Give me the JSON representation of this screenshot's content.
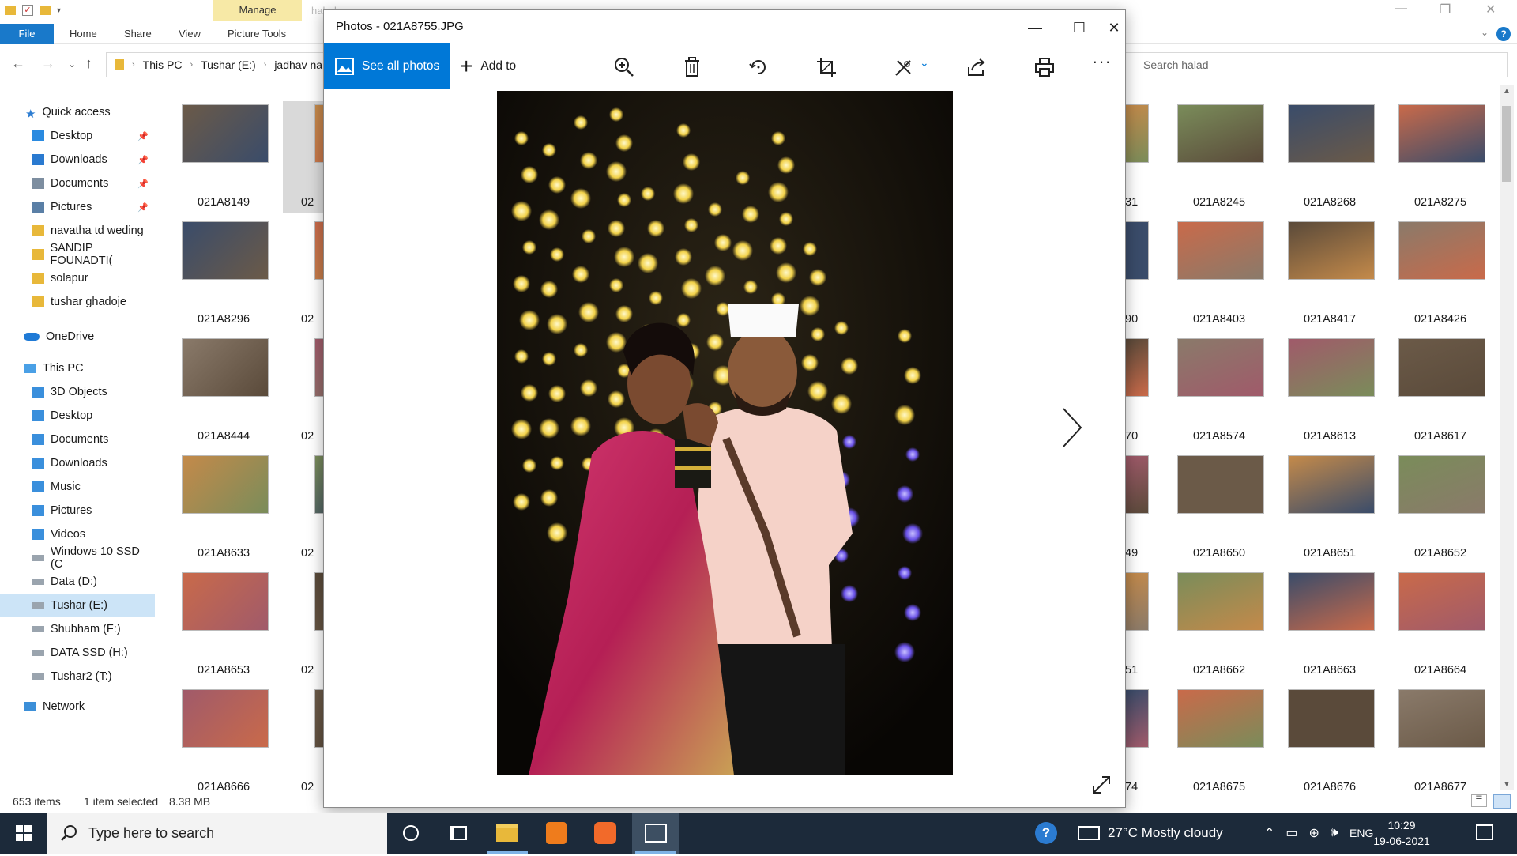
{
  "explorer": {
    "title_partial": "halad",
    "ribbon": {
      "contextual_tab": "Manage",
      "tabs": [
        "File",
        "Home",
        "Share",
        "View",
        "Picture Tools"
      ]
    },
    "breadcrumb": [
      "This PC",
      "Tushar (E:)",
      "jadhav na"
    ],
    "search_placeholder": "Search halad",
    "nav": {
      "quick_access": "Quick access",
      "quick_items": [
        "Desktop",
        "Downloads",
        "Documents",
        "Pictures",
        "navatha td weding",
        "SANDIP FOUNADTI(",
        "solapur",
        "tushar ghadoje"
      ],
      "onedrive": "OneDrive",
      "this_pc": "This PC",
      "pc_items": [
        "3D Objects",
        "Desktop",
        "Documents",
        "Downloads",
        "Music",
        "Pictures",
        "Videos",
        "Windows 10 SSD (C",
        "Data (D:)",
        "Tushar (E:)",
        "Shubham (F:)",
        "DATA SSD (H:)",
        "Tushar2 (T:)"
      ],
      "network": "Network"
    },
    "thumbs_left": [
      [
        "021A8149",
        "02"
      ],
      [
        "021A8296",
        "02"
      ],
      [
        "021A8444",
        "02"
      ],
      [
        "021A8633",
        "02"
      ],
      [
        "021A8653",
        "02"
      ],
      [
        "021A8666",
        "02"
      ]
    ],
    "thumbs_right": [
      [
        "31",
        "021A8245",
        "021A8268",
        "021A8275"
      ],
      [
        "90",
        "021A8403",
        "021A8417",
        "021A8426"
      ],
      [
        "70",
        "021A8574",
        "021A8613",
        "021A8617"
      ],
      [
        "49",
        "021A8650",
        "021A8651",
        "021A8652"
      ],
      [
        "51",
        "021A8662",
        "021A8663",
        "021A8664"
      ],
      [
        "74",
        "021A8675",
        "021A8676",
        "021A8677"
      ]
    ],
    "status": {
      "items": "653 items",
      "selected": "1 item selected",
      "size": "8.38 MB"
    }
  },
  "photos": {
    "title": "Photos - 021A8755.JPG",
    "see_all": "See all photos",
    "add_to": "Add to",
    "colors": {
      "accent": "#0078d7"
    }
  },
  "taskbar": {
    "search_placeholder": "Type here to search",
    "weather": "27°C  Mostly cloudy",
    "lang": "ENG",
    "time": "10:29",
    "date": "19-06-2021"
  }
}
